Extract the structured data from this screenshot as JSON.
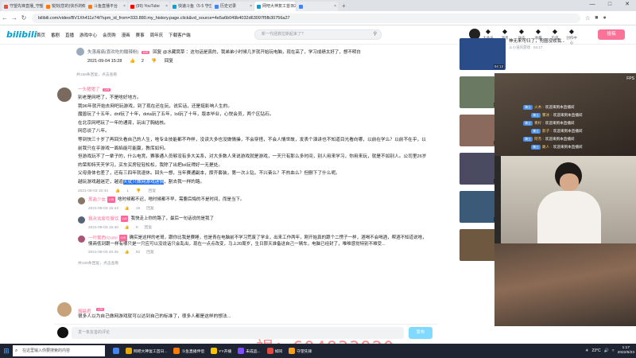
{
  "browser": {
    "tabs": [
      {
        "label": "守望先锋直播_守望先锋直播解说",
        "color": "#e64d3d"
      },
      {
        "label": "锐刻(您的)快乐的知视频_斗鱼直播平台",
        "color": "#ff7a00"
      },
      {
        "label": "斗鱼直播平台",
        "color": "#ff7a00"
      },
      {
        "label": "(99) YouTube",
        "color": "#ff0000"
      },
      {
        "label": "快速斗鱼（5·5 守卫~bil",
        "color": "#00a1d6"
      },
      {
        "label": "历史记录",
        "color": "#4285f4"
      },
      {
        "label": "网吧大神复工首日2026天神12500...",
        "color": "#00a1d6"
      },
      {
        "label": "",
        "color": "#4285f4"
      }
    ],
    "url_host": "bilibili.com",
    "url_rest": "/video/BV1Xh411z74t?spm_id_from=333.880.my_history.page.click&vd_source=4e5a6b049b4032d63097f5fb30756a27"
  },
  "site": {
    "logo": "bilibili",
    "menu": [
      "首页",
      "番剧",
      "直播",
      "游戏中心",
      "会员购",
      "漫画",
      "赛事",
      "周年庆",
      "下载客户端"
    ],
    "search_placeholder": "新一代拯救拉斯起来了?",
    "icons": [
      {
        "label": "大会员",
        "icon": "vip-icon"
      },
      {
        "label": "消息",
        "icon": "message-icon"
      },
      {
        "label": "动态",
        "icon": "dynamic-icon"
      },
      {
        "label": "收藏",
        "icon": "favorite-icon"
      },
      {
        "label": "历史",
        "icon": "history-icon"
      },
      {
        "label": "创作中心",
        "icon": "creator-icon"
      }
    ],
    "upload": "投稿"
  },
  "comments": {
    "top": {
      "user": "失落痛痛(喜欢吃的酸辣粉)",
      "reply_to": "@水藏窝草",
      "text": "回复 @水藏窝草 ：这句话是真的，我弟弟小时候几岁就开始玩电脑，现在高了，学习成绩太好了，想不明白",
      "time": "2021-09-04 15:28",
      "likes": "2",
      "replies": "共158条回复，点击查看"
    },
    "main": {
      "user": "一头猪猪了",
      "level": "LV5",
      "lines": [
        "别老是网吧了，不是啥好地方。",
        "我96年就开始去网吧玩游戏，到了现在还在玩，说实话，还是挺影响人生的。",
        "魔兽玩了十五年，dnf玩了十年，dota玩了五年，lol玩了十年，版本毕业，心悦会员，两个区钻石。",
        "在北京网吧玩了一年的通宵，玩出了胸结核。",
        "网恋谈了八年。",
        "等到快三十岁了再回头看自己的人生，啥专业技能都不咋样，没读大多也没做情操，不会穿搭，不会人情世故，发表个演讲也不知道目光看向哪，以前在学么？以前不在乎，以前我只在乎游戏一面掐能可能赢，教库如何。",
        "但游戏玩不了一辈子的，什么电竞，赛事通人员够没有多大关系，对大多数人来说游戏就是游戏，一天只有那么多时间，别人用来学习，你用来玩，就是不如别人。公司里26岁的荣和特天天学习，买车买房轻轻松松，我除了出把lol玩得好一无是处。",
        "父母身体也差了，还有三四年就退休。回头一想，当年赛通副本，攒齐套装，第一次上钻，不兴奋么？不热血么？但删下了什么呢。"
      ],
      "hl_prefix": "越玩游戏越迷茫，越追",
      "hl_text": "天就只做网游戏迷惘",
      "hl_suffix": "，割去我一样的路。",
      "time": "2021-08-03 10:44",
      "likes": "1",
      "replies_link": "共109条回复，点击查看",
      "subreplies": [
        {
          "user": "黑盐少女",
          "level": "LV5",
          "text": "啥时候都不迟，啥时候都不早，需要后悔的不是时间，而是当下。",
          "time": "2021-08-03 15:44",
          "likes": "19",
          "color": "#887766"
        },
        {
          "user": "我永远爱吃餐饮",
          "level": "LV4",
          "text": "我快走上你的路了，最后一句话说的是我了",
          "time": "2021-08-03 16:40",
          "likes": "8",
          "color": "#556677"
        },
        {
          "user": "一叶蜜西rizumi",
          "level": "LV5",
          "text": "确实是这样的老哥，跟你比我是赛睡，也是青在电脑前不学习荒废了学业，出来工作两年，刚开始真的跟个二愣子一样，酒喝不会喝酒，帮酒不知道说啥，情商低到跟一样有哪只是一只应可以没说话只会乱出，现在一点点改变，马上20周岁，生日那天准备送自己一辆车，电脑已经封了，唯唯感觉特别不难受...",
          "time": "2021-08-03 20:45",
          "likes": "62",
          "color": "#aa5577"
        }
      ],
      "sub_more": "共109条回复，点击查看"
    },
    "last": {
      "user": "烟晨君",
      "level": "LV5",
      "text": "很多人以为自己做网游戏就可以达到自己的标准了，很多人都是这样的想法..."
    },
    "composer_placeholder": "发一条友善的评论",
    "composer_button": "发布"
  },
  "recs": [
    {
      "title": "神无来可归了，兜圈没收我...",
      "meta": "斗小溪的游戏 · 04:17",
      "dur": "04:13",
      "color": "#2a4d8a"
    },
    {
      "title": "表妹来到清店一个月都没找到工作，在不见这里，嚷了吧",
      "meta": "大叔 10",
      "dur": "05:42",
      "color": "#6a7a62"
    },
    {
      "title": "最初cpc成功做到加速，开始选择一个游戏 ...",
      "meta": "1·1万 · 58",
      "dur": "19:42",
      "color": "#8a6a5c"
    },
    {
      "title": "我们玩游戏的都回答是怎么开始学习的，经验知识...",
      "meta": "5万 · 32",
      "dur": "04:30",
      "color": "#4a4a60"
    },
    {
      "title": "91大神的演示作品，值得分享下",
      "meta": "3·3万 · 16",
      "dur": "07:13",
      "color": "#3b5a78"
    },
    {
      "title": "活，人生短暂的十载，游戏",
      "meta": "",
      "dur": "",
      "color": "#6e5840"
    }
  ],
  "stream": {
    "danmu": [
      {
        "badge": "骑士",
        "name": "火木 :",
        "text": "欢迎来到本直播间"
      },
      {
        "badge": "骑士",
        "name": "雾冰 :",
        "text": "欢迎来到本直播间"
      },
      {
        "badge": "骑士",
        "name": "青柠 :",
        "text": "欢迎来到本直播间"
      },
      {
        "badge": "骑士",
        "name": "影子 :",
        "text": "欢迎来到本直播间"
      },
      {
        "badge": "骑士",
        "name": "阿杰 :",
        "text": "欢迎来到本直播间"
      },
      {
        "badge": "骑士",
        "name": "路人 :",
        "text": "欢迎来到本直播间"
      }
    ],
    "fps": "FPS"
  },
  "watermark": "褐：604833920",
  "taskbar": {
    "search_placeholder": "在这里输入你要搜索的内容",
    "apps": [
      {
        "label": "",
        "color": "#4285f4"
      },
      {
        "label": "网吧大神复工首日...",
        "color": "#e5a90c"
      },
      {
        "label": "斗鱼直播伴侣",
        "color": "#ff7a00"
      },
      {
        "label": "YY开播",
        "color": "#f7c400"
      },
      {
        "label": "未成品...",
        "color": "#7d4fff"
      },
      {
        "label": "如同",
        "color": "#e5483d"
      },
      {
        "label": "守望先锋",
        "color": "#f99e1a"
      }
    ],
    "weather": "23°C",
    "time": "1:17",
    "date": "2022/6/23"
  }
}
